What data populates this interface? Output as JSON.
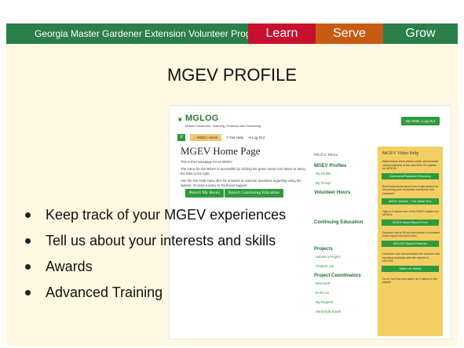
{
  "banner": {
    "program": "Georgia Master Gardener Extension Volunteer Program",
    "learn": "Learn",
    "serve": "Serve",
    "grow": "Grow"
  },
  "title": "MGEV PROFILE",
  "site": {
    "logo_name": "MGLOG",
    "logo_tagline": "Master Gardeners. Learning, Outreach and Gardening",
    "login": "My Stats | Log Out",
    "nav": {
      "home_label": "MGEV Home",
      "help_label": "Get Help",
      "logout_label": "Log Out"
    },
    "heading": "MGEV Home Page",
    "para1": "This is the homepage for an MGEV.",
    "para2": "The menu for the MGEV is accessible by clicking the green menu icon above or using the links to the right.",
    "para3": "Use the Get Help menu item for answers to common questions regarding using the system. Or send a query to Technical Support.",
    "btn_hours": "Report My Hours",
    "btn_ce": "Report Continuing Education",
    "menu": {
      "title": "MGEV Menu",
      "profiles_head": "MGEV Profiles",
      "my_profile": "My Profile",
      "my_group": "My Group",
      "volunteer_head": "Volunteer Hours",
      "continuing_head": "Continuing Education",
      "projects_head": "Projects",
      "submit_project": "Submit a Project",
      "projects_list": "Projects List",
      "coordinators_head": "Project Coordinators",
      "new_ear": "New EAR",
      "ear_list": "EAR List",
      "my_projects": "My Projects",
      "send_bulk": "Send Bulk Email"
    },
    "help": {
      "title": "MGEV Video Help",
      "t1": "Watch these short videos which demonstrate various aspects of the new MGLOG system for MGEVs.",
      "b1": "Username/Password Recovery",
      "t2": "Brief instructions about how to get started by recovering your temporary username and password.",
      "b2": "MGEV Section - The Nickel Tour",
      "t3": "Take a 4 minute tour of the MGEV system for MGEVs.",
      "b3": "MGEV Hours Report Form",
      "t4": "Explains how to fill out and submit a volunteer hours report form and more.",
      "b4": "MGLOG Report Features",
      "t5": "Describes and demonstrates the features and functions available with the reports in MGLOG.",
      "b5": "Watch all Videos",
      "t6": "Go to YouTube and watch all 4 videos in the playlist"
    }
  },
  "bullets": [
    "Keep track of your MGEV experiences",
    "Tell us about your interests and skills",
    "Awards",
    "Advanced Training"
  ],
  "colors": {
    "banner_green": "#2a7f4a",
    "learn_red": "#c8102e",
    "serve_orange": "#c75b14",
    "background_cream": "#fff8e2",
    "help_yellow": "#f3cf63"
  }
}
